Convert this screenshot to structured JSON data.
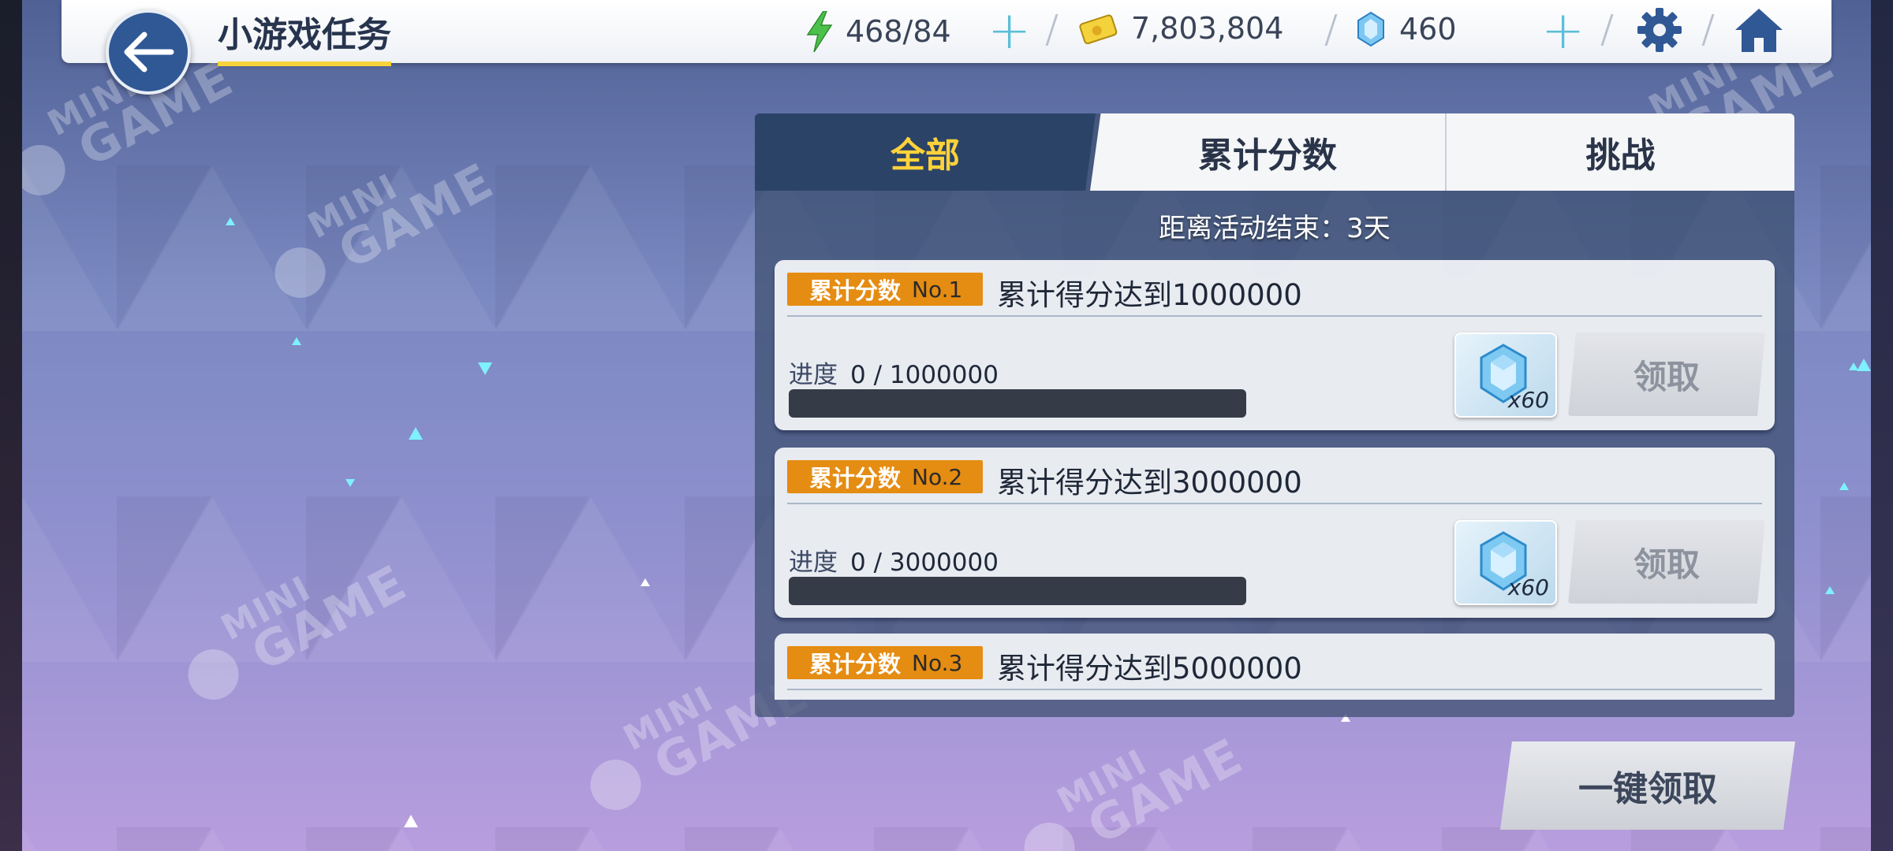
{
  "header": {
    "title": "小游戏任务",
    "stamina": "468/84",
    "coins": "7,803,804",
    "crystals": "460",
    "icons": {
      "back": "back-arrow-icon",
      "stamina": "lightning-icon",
      "coins": "coin-card-icon",
      "crystals": "crystal-icon",
      "settings": "gear-icon",
      "home": "home-icon"
    }
  },
  "tabs": {
    "all": "全部",
    "score": "累计分数",
    "challenge": "挑战",
    "active": "全部"
  },
  "countdown": "距离活动结束：3天",
  "tasks": [
    {
      "tag": "累计分数",
      "number": "No.1",
      "title": "累计得分达到1000000",
      "progress_label": "进度",
      "progress_text": "0 / 1000000",
      "progress_fraction": 0,
      "reward_qty": "x60",
      "claim_label": "领取"
    },
    {
      "tag": "累计分数",
      "number": "No.2",
      "title": "累计得分达到3000000",
      "progress_label": "进度",
      "progress_text": "0 / 3000000",
      "progress_fraction": 0,
      "reward_qty": "x60",
      "claim_label": "领取"
    },
    {
      "tag": "累计分数",
      "number": "No.3",
      "title": "累计得分达到5000000"
    }
  ],
  "claim_all": "一键领取",
  "watermark": {
    "line1": "MINI",
    "line2": "GAME"
  },
  "colors": {
    "accent_yellow": "#ffd23a",
    "tag_orange": "#e58c12",
    "tab_active_bg": "#2b4367",
    "back_button": "#2f5895",
    "plus": "#5bbfd8"
  }
}
